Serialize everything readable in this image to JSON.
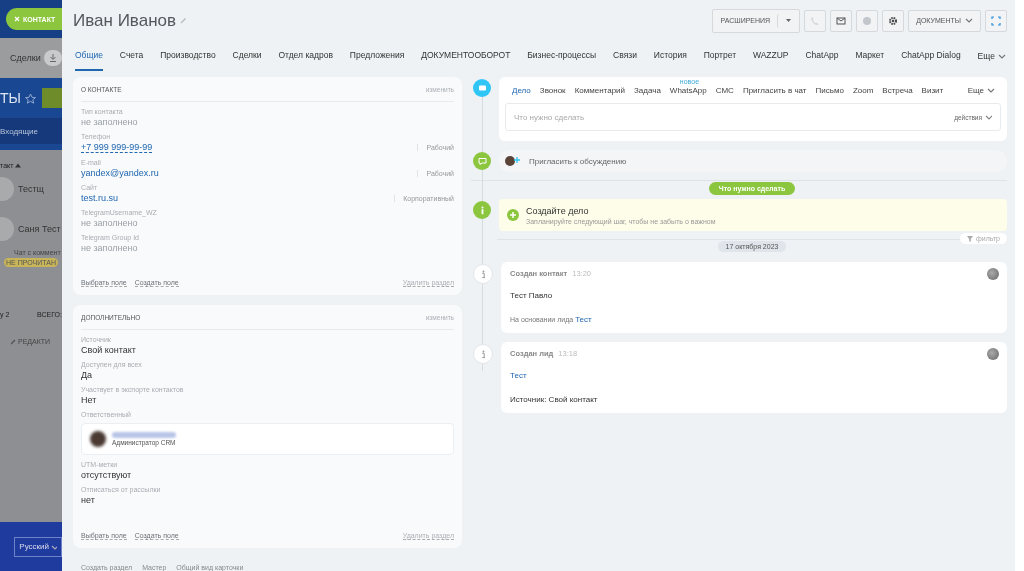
{
  "background_page": {
    "close_button": "КОНТАКТ",
    "deals_label": "Сделки",
    "title": "ТЫ",
    "inbox": "Входящие",
    "column_header": "такт",
    "contacts": [
      {
        "name": "Тестщ"
      },
      {
        "name": "Саня Тест",
        "note": "Чат с коммент",
        "badge": "НЕ ПРОЧИТАН"
      }
    ],
    "pager": "у 2",
    "total": "ВСЕГО:",
    "edit": "РЕДАКТИ",
    "language": "Русский"
  },
  "header": {
    "title": "Иван Иванов",
    "extensions_button": "РАСШИРЕНИЯ",
    "documents_button": "ДОКУМЕНТЫ"
  },
  "tabs": [
    {
      "label": "Общие",
      "selected": true
    },
    {
      "label": "Счета",
      "selected": false
    },
    {
      "label": "Производство",
      "selected": false
    },
    {
      "label": "Сделки",
      "selected": false
    },
    {
      "label": "Отдел кадров",
      "selected": false
    },
    {
      "label": "Предложения",
      "selected": false
    },
    {
      "label": "ДОКУМЕНТООБОРОТ",
      "selected": false
    },
    {
      "label": "Бизнес-процессы",
      "selected": false
    },
    {
      "label": "Связи",
      "selected": false
    },
    {
      "label": "История",
      "selected": false
    },
    {
      "label": "Портрет",
      "selected": false
    },
    {
      "label": "WAZZUP",
      "selected": false
    },
    {
      "label": "ChatApp",
      "selected": false
    },
    {
      "label": "Маркет",
      "selected": false
    },
    {
      "label": "ChatApp Dialog",
      "selected": false
    }
  ],
  "tabs_more": "Еще",
  "sections": [
    {
      "title": "О КОНТАКТЕ",
      "edit": "изменить",
      "fields": [
        {
          "label": "Тип контакта",
          "value": "не заполнено",
          "kind": "empty"
        },
        {
          "label": "Телефон",
          "value": "+7 999 999-99-99",
          "kind": "phone",
          "type": "Рабочий"
        },
        {
          "label": "E-mail",
          "value": "yandex@yandex.ru",
          "kind": "link",
          "type": "Рабочий"
        },
        {
          "label": "Сайт",
          "value": "test.ru.su",
          "kind": "link",
          "type": "Корпоративный"
        },
        {
          "label": "TelegramUsername_WZ",
          "value": "не заполнено",
          "kind": "empty"
        },
        {
          "label": "Telegram Group Id",
          "value": "не заполнено",
          "kind": "empty"
        }
      ],
      "select_field": "Выбрать поле",
      "create_field": "Создать поле",
      "delete": "Удалить раздел"
    },
    {
      "title": "ДОПОЛНИТЕЛЬНО",
      "edit": "изменить",
      "fields": [
        {
          "label": "Источник",
          "value": "Свой контакт",
          "kind": "text"
        },
        {
          "label": "Доступен для всех",
          "value": "Да",
          "kind": "text"
        },
        {
          "label": "Участвует в экспорте контактов",
          "value": "Нет",
          "kind": "text"
        },
        {
          "label": "Ответственный",
          "value": "Администратор CRM",
          "kind": "user"
        },
        {
          "label": "UTM-метки",
          "value": "отсутствуют",
          "kind": "text"
        },
        {
          "label": "Отписаться от рассылки",
          "value": "нет",
          "kind": "text"
        }
      ],
      "select_field": "Выбрать поле",
      "create_field": "Создать поле",
      "delete": "Удалить раздел"
    }
  ],
  "bottom_links": [
    "Создать раздел",
    "Мастер",
    "Общий вид карточки"
  ],
  "activity": {
    "tabs": [
      {
        "label": "Дело",
        "selected": true
      },
      {
        "label": "Звонок",
        "selected": false
      },
      {
        "label": "Комментарий",
        "selected": false
      },
      {
        "label": "Задача",
        "selected": false
      },
      {
        "label": "WhatsApp",
        "selected": false,
        "badge": "новое"
      },
      {
        "label": "СМС",
        "selected": false
      },
      {
        "label": "Пригласить в чат",
        "selected": false
      },
      {
        "label": "Письмо",
        "selected": false
      },
      {
        "label": "Zoom",
        "selected": false
      },
      {
        "label": "Встреча",
        "selected": false
      },
      {
        "label": "Визит",
        "selected": false
      }
    ],
    "more": "Еще",
    "placeholder": "Что нужно сделать",
    "actions": "действия"
  },
  "invite": "Пригласить к обсуждению",
  "todo_badge": "Что нужно сделать",
  "create_task": {
    "title": "Создайте дело",
    "hint": "Запланируйте следующий шаг, чтобы не забыть о важном"
  },
  "date": "17 октября 2023",
  "filter": "фильтр",
  "history": [
    {
      "title": "Создан контакт",
      "time": "13:20",
      "lines": [
        {
          "text": "Тест Павло"
        },
        {
          "prefix": "На основании лида",
          "link": "Тест"
        }
      ]
    },
    {
      "title": "Создан лид",
      "time": "13:18",
      "lines": [
        {
          "link": "Тест"
        },
        {
          "text": "Источник: Свой контакт"
        }
      ]
    }
  ]
}
